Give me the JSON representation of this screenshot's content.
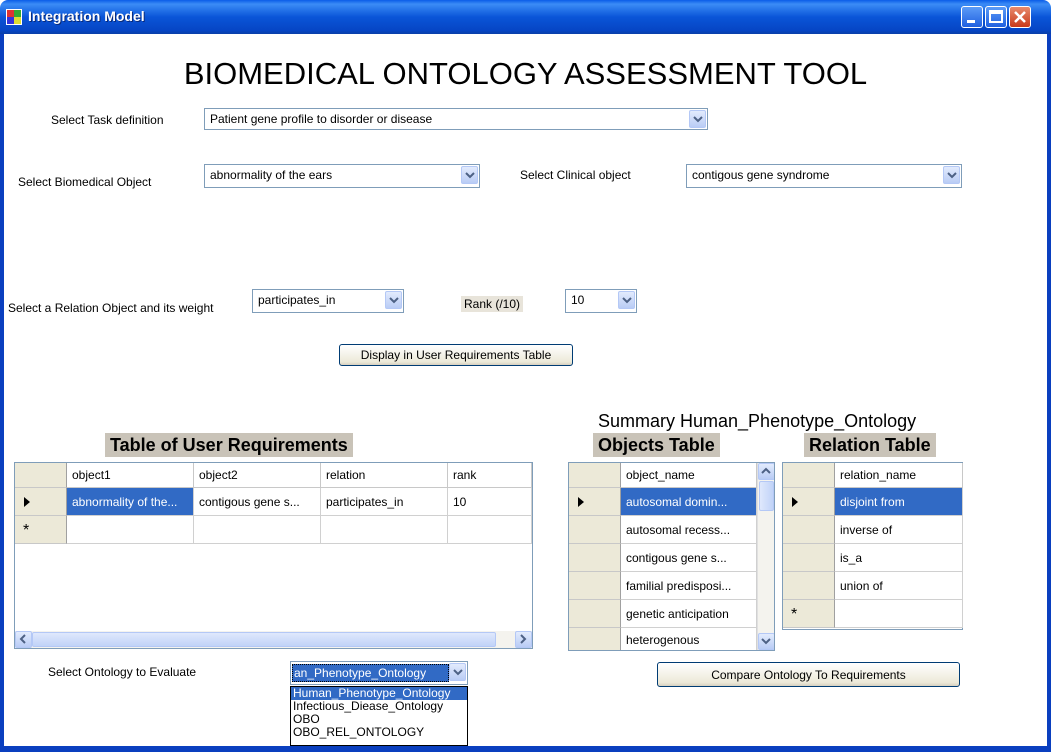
{
  "window": {
    "title": "Integration Model"
  },
  "heading": "BIOMEDICAL ONTOLOGY ASSESSMENT TOOL",
  "task": {
    "label": "Select Task definition",
    "value": "Patient gene profile to disorder or disease"
  },
  "biomedical": {
    "label": "Select Biomedical Object",
    "value": "abnormality of the ears"
  },
  "clinical": {
    "label": "Select  Clinical  object",
    "value": "contigous gene syndrome"
  },
  "relation": {
    "label": "Select a Relation Object and its weight",
    "value": "participates_in"
  },
  "rank": {
    "label": "Rank  (/10)",
    "value": "10"
  },
  "display_button": "Display in User Requirements Table",
  "summary_title": "Summary  Human_Phenotype_Ontology",
  "user_table": {
    "title": "Table of User Requirements",
    "columns": [
      "object1",
      "object2",
      "relation",
      "rank"
    ],
    "rows": [
      [
        "abnormality of the...",
        "contigous gene s...",
        "participates_in",
        "10"
      ]
    ],
    "new_row_marker": "*"
  },
  "objects_table": {
    "title": "Objects Table",
    "column": "object_name",
    "rows": [
      "autosomal domin...",
      "autosomal recess...",
      "contigous gene s...",
      "familial predisposi...",
      "genetic anticipation",
      "heterogenous"
    ]
  },
  "relation_table": {
    "title": "Relation Table",
    "column": "relation_name",
    "rows": [
      "disjoint from",
      "inverse of",
      "is_a",
      "union of"
    ],
    "new_row_marker": "*"
  },
  "ontology_select": {
    "label": "Select Ontology to Evaluate",
    "value": "an_Phenotype_Ontology",
    "options": [
      "Human_Phenotype_Ontology",
      "Infectious_Diease_Ontology",
      "OBO",
      "OBO_REL_ONTOLOGY"
    ]
  },
  "compare_button": "Compare Ontology To Requirements",
  "colors": {
    "titlebar": "#0a55d8",
    "selection": "#316ac5",
    "section_bg": "#c9c3b8"
  }
}
